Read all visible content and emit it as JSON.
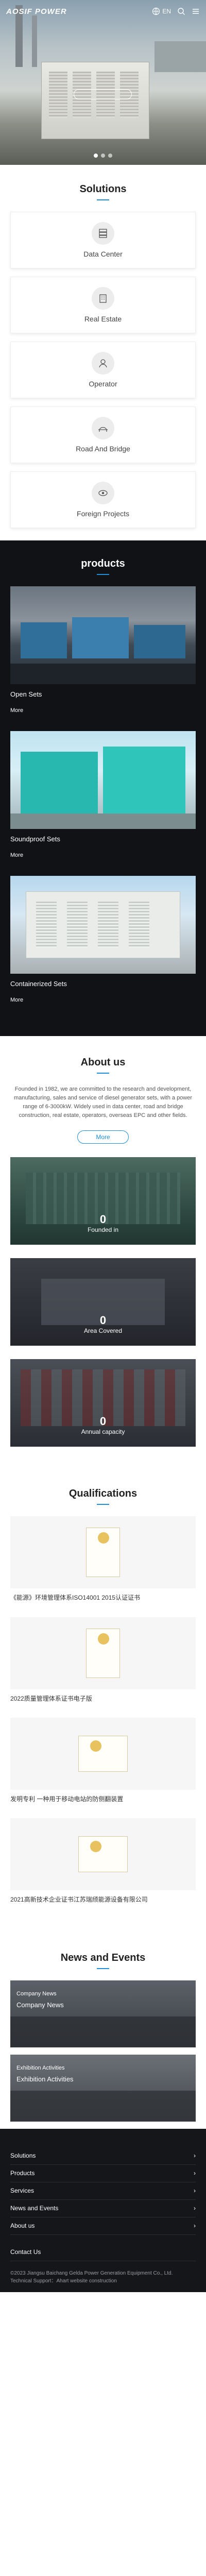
{
  "header": {
    "logo": "AOSIF POWER",
    "lang": "EN"
  },
  "hero": {
    "button_label": ""
  },
  "solutions": {
    "title": "Solutions",
    "items": [
      {
        "label": "Data Center",
        "icon": "data-center-icon"
      },
      {
        "label": "Real Estate",
        "icon": "building-icon"
      },
      {
        "label": "Operator",
        "icon": "operator-icon"
      },
      {
        "label": "Road And Bridge",
        "icon": "bridge-icon"
      },
      {
        "label": "Foreign Projects",
        "icon": "globe-icon"
      }
    ]
  },
  "products": {
    "title": "products",
    "more": "More",
    "items": [
      {
        "name": "Open Sets"
      },
      {
        "name": "Soundproof Sets"
      },
      {
        "name": "Containerized Sets"
      }
    ]
  },
  "about": {
    "title": "About us",
    "text": "Founded in 1982, we are committed to the research and development, manufacturing, sales and service of diesel generator sets, with a power range of 6-3000kW. Widely used in data center, road and bridge construction, real estate, operators, overseas EPC and other fields.",
    "button": "More",
    "stats": [
      {
        "num": "0",
        "label": "Founded in"
      },
      {
        "num": "0",
        "label": "Area Covered"
      },
      {
        "num": "0",
        "label": "Annual capacity"
      }
    ]
  },
  "qualifications": {
    "title": "Qualifications",
    "items": [
      {
        "caption": "《能源》环境管理体系ISO14001 2015认证证书"
      },
      {
        "caption": "2022质量管理体系证书电子版"
      },
      {
        "caption": "发明专利 一种用于移动电站的防侧翻装置"
      },
      {
        "caption": "2021高新技术企业证书江苏瑞颀能源设备有限公司"
      }
    ]
  },
  "news": {
    "title": "News and Events",
    "items": [
      {
        "category": "Company News",
        "title": "Company News"
      },
      {
        "category": "Exhibition Activities",
        "title": "Exhibition Activities"
      }
    ]
  },
  "footer": {
    "links": [
      "Solutions",
      "Products",
      "Services",
      "News and Events",
      "About us"
    ],
    "contact": "Contact Us",
    "copyright": "©2023 Jiangsu Baichang Gelda Power Generation Equipment Co., Ltd.",
    "support": "Technical Support：Ahart website construction"
  }
}
